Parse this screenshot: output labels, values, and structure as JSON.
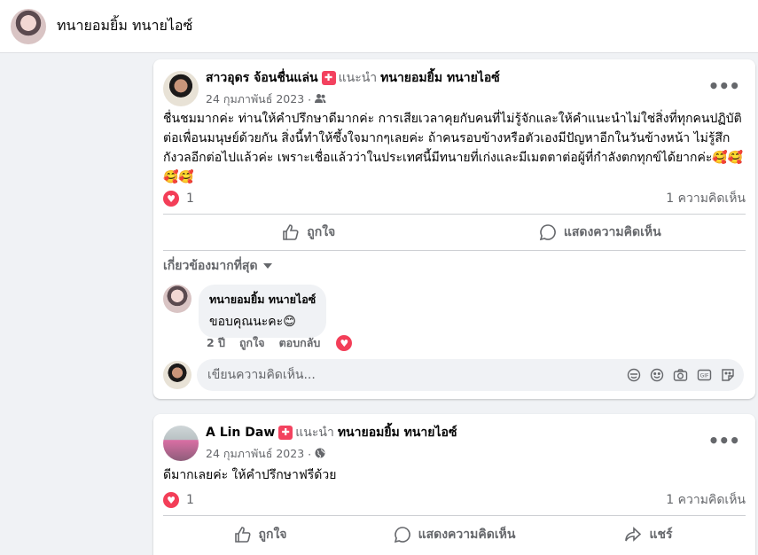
{
  "header": {
    "title": "ทนายอมยิ้ม ทนายไอซ์"
  },
  "posts": [
    {
      "author": "สาวอุดร จ้อนชื่นแล่น",
      "recommends": "แนะนำ",
      "page": "ทนายอมยิ้ม ทนายไอซ์",
      "date": "24 กุมภาพันธ์ 2023",
      "sep": "·",
      "audience_icon": "friends-icon",
      "text": "ชื่นชมมากค่ะ ท่านให้คำปรึกษาดีมากค่ะ การเสียเวลาคุยกับคนที่ไม่รู้จักและให้คำแนะนำไม่ใช่สิ่งที่ทุกคนปฏิบัติต่อเพื่อนมนุษย์ด้วยกัน สิ่งนี้ทำให้ซึ้งใจมากๆเลยค่ะ ถ้าคนรอบข้างหรือตัวเองมีปัญหาอีกในวันข้างหน้า ไม่รู้สึกกังวลอีกต่อไปแล้วค่ะ เพราะเชื่อแล้วว่าในประเทศนี้มีทนายที่เก่งและมีเมตตาต่อผู้ที่กำลังตกทุกข์ได้ยากค่ะ🥰🥰🥰🥰",
      "reaction_count": "1",
      "comment_count": "1 ความคิดเห็น",
      "actions": {
        "like": "ถูกใจ",
        "comment": "แสดงความคิดเห็น"
      },
      "sort_label": "เกี่ยวข้องมากที่สุด",
      "comment": {
        "name": "ทนายอมยิ้ม ทนายไอซ์",
        "text": "ขอบคุณนะคะ😊",
        "time": "2 ปี",
        "like": "ถูกใจ",
        "reply": "ตอบกลับ"
      },
      "composer_placeholder": "เขียนความคิดเห็น..."
    },
    {
      "author": "A Lin Daw",
      "recommends": "แนะนำ",
      "page": "ทนายอมยิ้ม ทนายไอซ์",
      "date": "24 กุมภาพันธ์ 2023",
      "sep": "·",
      "audience_icon": "globe-icon",
      "text": "ดีมากเลยค่ะ  ให้คำปรึกษาฟรีด้วย",
      "reaction_count": "1",
      "comment_count": "1 ความคิดเห็น",
      "actions": {
        "like": "ถูกใจ",
        "comment": "แสดงความคิดเห็น",
        "share": "แชร์"
      }
    }
  ],
  "colors": {
    "heart": "#f33e58",
    "badge": "#f3425f",
    "secondary_text": "#65676b"
  }
}
